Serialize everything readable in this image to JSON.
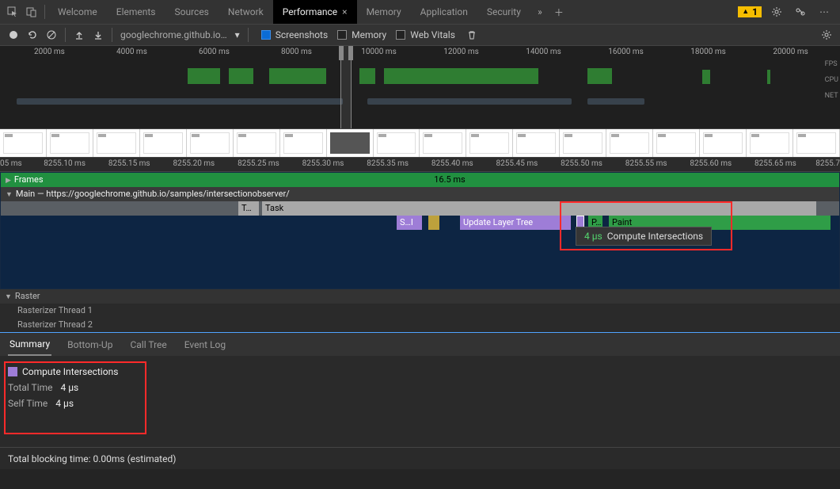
{
  "tabs": {
    "list": [
      "Welcome",
      "Elements",
      "Sources",
      "Network",
      "Performance",
      "Memory",
      "Application",
      "Security"
    ],
    "active": "Performance",
    "warn_count": "1"
  },
  "toolbar": {
    "url": "googlechrome.github.io…",
    "screenshots_label": "Screenshots",
    "memory_label": "Memory",
    "web_vitals_label": "Web Vitals"
  },
  "overview": {
    "ticks": [
      "2000 ms",
      "4000 ms",
      "6000 ms",
      "8000 ms",
      "10000 ms",
      "12000 ms",
      "14000 ms",
      "16000 ms",
      "18000 ms",
      "20000 ms"
    ],
    "lanes": [
      "FPS",
      "CPU",
      "NET"
    ]
  },
  "detail_ruler": {
    "ticks": [
      "05 ms",
      "8255.10 ms",
      "8255.15 ms",
      "8255.20 ms",
      "8255.25 ms",
      "8255.30 ms",
      "8255.35 ms",
      "8255.40 ms",
      "8255.45 ms",
      "8255.50 ms",
      "8255.55 ms",
      "8255.60 ms",
      "8255.65 ms",
      "8255.7"
    ]
  },
  "flame": {
    "frames_label": "Frames",
    "frame_duration": "16.5 ms",
    "main_label": "Main — https://googlechrome.github.io/samples/intersectionobserver/",
    "t_label": "T…",
    "task_label": "Task",
    "si_label": "S…I",
    "update_label": "Update Layer Tree",
    "p_label": "P…",
    "paint_label": "Paint",
    "tooltip_dur": "4 µs",
    "tooltip_name": "Compute Intersections",
    "raster_label": "Raster",
    "raster_rows": [
      "Rasterizer Thread 1",
      "Rasterizer Thread 2"
    ]
  },
  "bottom": {
    "tabs": [
      "Summary",
      "Bottom-Up",
      "Call Tree",
      "Event Log"
    ],
    "active": "Summary",
    "event_name": "Compute Intersections",
    "total_label": "Total Time",
    "total_val": "4 µs",
    "self_label": "Self Time",
    "self_val": "4 µs",
    "blocking": "Total blocking time: 0.00ms (estimated)"
  }
}
